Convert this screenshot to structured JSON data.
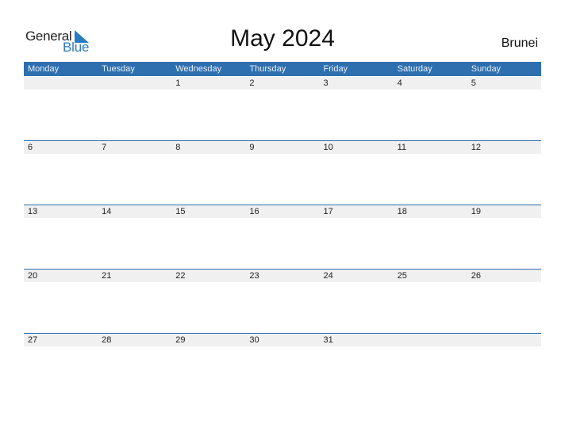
{
  "logo": {
    "line1": "General",
    "line2": "Blue",
    "icon": "triangle-flag-icon"
  },
  "title": "May 2024",
  "country": "Brunei",
  "colors": {
    "accent": "#2e6fb0",
    "strip": "#f0f0f0",
    "logo_blue": "#2b7bc0"
  },
  "days": [
    "Monday",
    "Tuesday",
    "Wednesday",
    "Thursday",
    "Friday",
    "Saturday",
    "Sunday"
  ],
  "weeks": [
    [
      "",
      "",
      "1",
      "2",
      "3",
      "4",
      "5"
    ],
    [
      "6",
      "7",
      "8",
      "9",
      "10",
      "11",
      "12"
    ],
    [
      "13",
      "14",
      "15",
      "16",
      "17",
      "18",
      "19"
    ],
    [
      "20",
      "21",
      "22",
      "23",
      "24",
      "25",
      "26"
    ],
    [
      "27",
      "28",
      "29",
      "30",
      "31",
      "",
      ""
    ]
  ]
}
